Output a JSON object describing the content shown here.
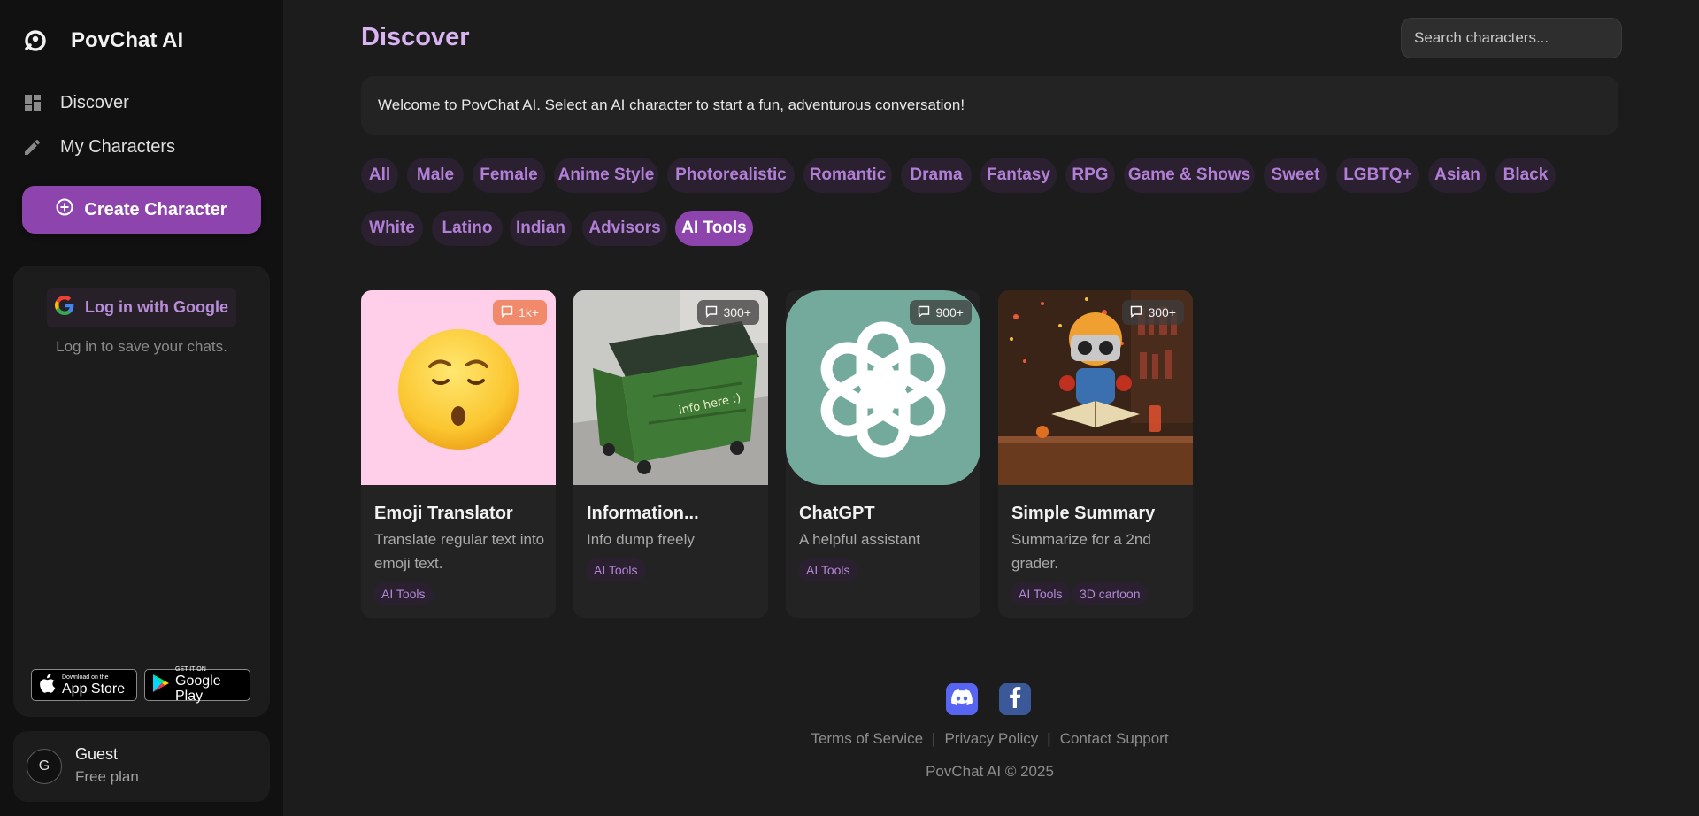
{
  "app": {
    "name": "PovChat AI"
  },
  "sidebar": {
    "nav": [
      {
        "label": "Discover",
        "icon": "dashboard-icon"
      },
      {
        "label": "My Characters",
        "icon": "pencil-icon"
      }
    ],
    "create_label": "Create Character",
    "login": {
      "google_label": "Log in with Google",
      "hint": "Log in to save your chats."
    },
    "stores": {
      "apple_small": "Download on the",
      "apple_big": "App Store",
      "google_small": "GET IT ON",
      "google_big": "Google Play"
    },
    "user": {
      "initial": "G",
      "name": "Guest",
      "plan": "Free plan"
    }
  },
  "main": {
    "title": "Discover",
    "search_placeholder": "Search characters...",
    "welcome": "Welcome to PovChat AI. Select an AI character to start a fun, adventurous conversation!",
    "categories": [
      "All",
      "Male",
      "Female",
      "Anime Style",
      "Photorealistic",
      "Romantic",
      "Drama",
      "Fantasy",
      "RPG",
      "Game & Shows",
      "Sweet",
      "LGBTQ+",
      "Asian",
      "Black",
      "White",
      "Latino",
      "Indian",
      "Advisors",
      "AI Tools"
    ],
    "active_category": "AI Tools",
    "cards": [
      {
        "title": "Emoji Translator",
        "desc": "Translate regular text into emoji text.",
        "count": "1k+",
        "tags": [
          "AI Tools"
        ]
      },
      {
        "title": "Information...",
        "desc": "Info dump freely",
        "count": "300+",
        "tags": [
          "AI Tools"
        ],
        "image_text": "info here :)"
      },
      {
        "title": "ChatGPT",
        "desc": "A helpful assistant",
        "count": "900+",
        "tags": [
          "AI Tools"
        ]
      },
      {
        "title": "Simple Summary",
        "desc": "Summarize for a 2nd grader.",
        "count": "300+",
        "tags": [
          "AI Tools",
          "3D cartoon"
        ]
      }
    ]
  },
  "footer": {
    "links": [
      "Terms of Service",
      "Privacy Policy",
      "Contact Support"
    ],
    "separator": "|",
    "copyright": "PovChat AI © 2025"
  },
  "colors": {
    "accent": "#8e44ad",
    "title": "#d9b3f2",
    "chip_text": "#b27fd6",
    "discord": "#5865f2",
    "facebook": "#3b5998"
  }
}
